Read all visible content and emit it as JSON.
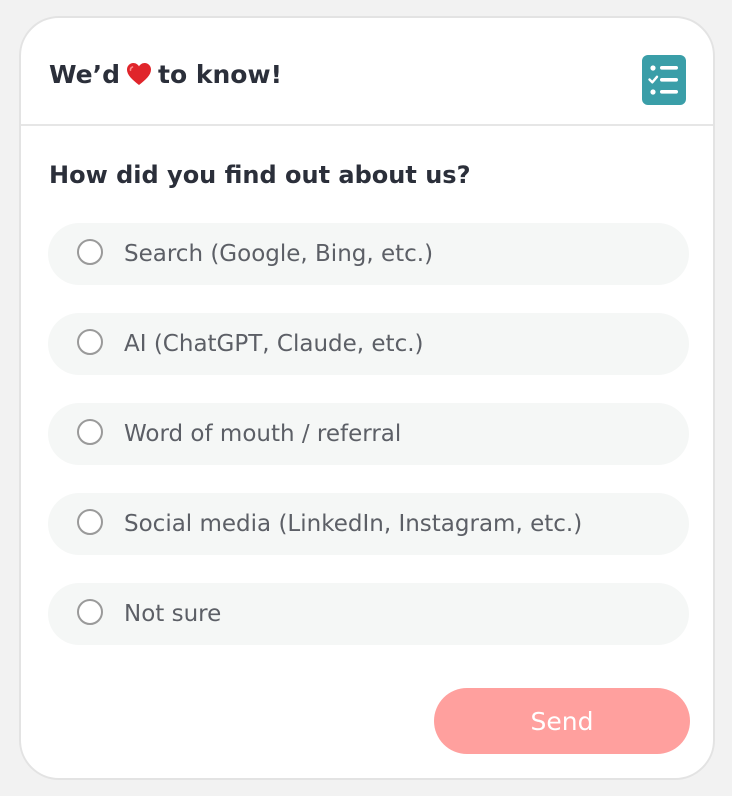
{
  "header": {
    "title_before": "We’d",
    "title_emoji": "❤️",
    "title_after": "to know!",
    "icon": "checklist-icon"
  },
  "question": {
    "text": "How did you find out about us?"
  },
  "options": [
    {
      "label": "Search (Google, Bing, etc.)"
    },
    {
      "label": "AI (ChatGPT, Claude, etc.)"
    },
    {
      "label": "Word of mouth / referral"
    },
    {
      "label": "Social media (LinkedIn, Instagram, etc.)"
    },
    {
      "label": "Not sure"
    }
  ],
  "send": {
    "label": "Send"
  },
  "colors": {
    "accent": "#3a9ea8",
    "send_button": "#ffa09e",
    "heart": "#e0252b",
    "option_background": "#f5f7f6"
  }
}
